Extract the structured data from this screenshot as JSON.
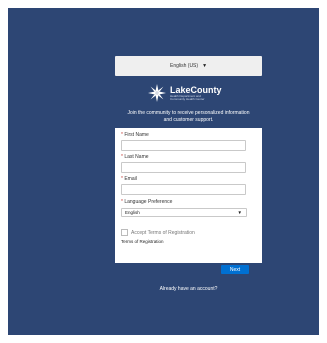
{
  "language_bar": {
    "selected": "English (US)"
  },
  "logo": {
    "brand": "LakeCounty",
    "sub_line1": "Health Department and",
    "sub_line2": "Community Health Center",
    "icon": "star-burst-icon"
  },
  "intro": {
    "line1": "Join the community to receive personalized information",
    "line2": "and customer support."
  },
  "form": {
    "first_name_label": "First Name",
    "last_name_label": "Last Name",
    "email_label": "Email",
    "language_pref_label": "Language Preference",
    "language_pref_value": "English",
    "required_mark": "*",
    "accept_terms_label": "Accept Terms of Registration",
    "terms_link": "Terms of Registration",
    "next_button": "Next"
  },
  "footer": {
    "already_account": "Already have an account?"
  },
  "colors": {
    "background": "#2d4674",
    "accent": "#0070d2",
    "required": "#c23934"
  }
}
